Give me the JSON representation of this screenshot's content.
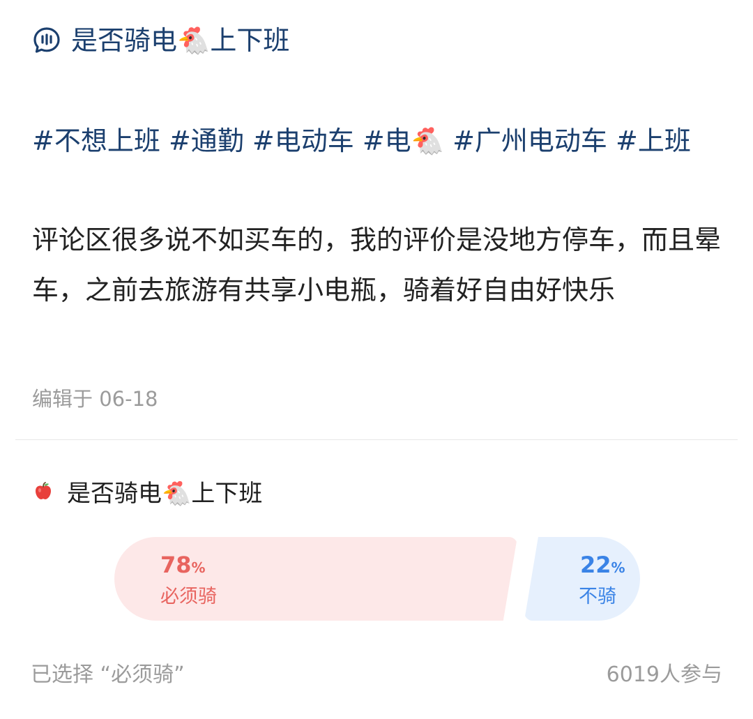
{
  "post": {
    "title": "是否骑电🐔上下班",
    "hashtags": [
      "#不想上班",
      "#通勤",
      "#电动车",
      "#电🐔",
      "#广州电动车",
      "#上班"
    ],
    "body": "评论区很多说不如买车的，我的评价是没地方停车，而且晕车，之前去旅游有共享小电瓶，骑着好自由好快乐",
    "edited": "编辑于 06-18"
  },
  "poll": {
    "title": "是否骑电🐔上下班",
    "options": [
      {
        "percent": "78",
        "unit": "%",
        "label": "必须骑",
        "share": 0.78,
        "color": "#e8645f"
      },
      {
        "percent": "22",
        "unit": "%",
        "label": "不骑",
        "share": 0.22,
        "color": "#3a83e6"
      }
    ],
    "selected_text": "已选择 “必须骑”",
    "participants": "6019人参与"
  },
  "icons": {
    "title_icon": "chat-bubble-icon",
    "poll_icon": "red-apple-icon"
  }
}
